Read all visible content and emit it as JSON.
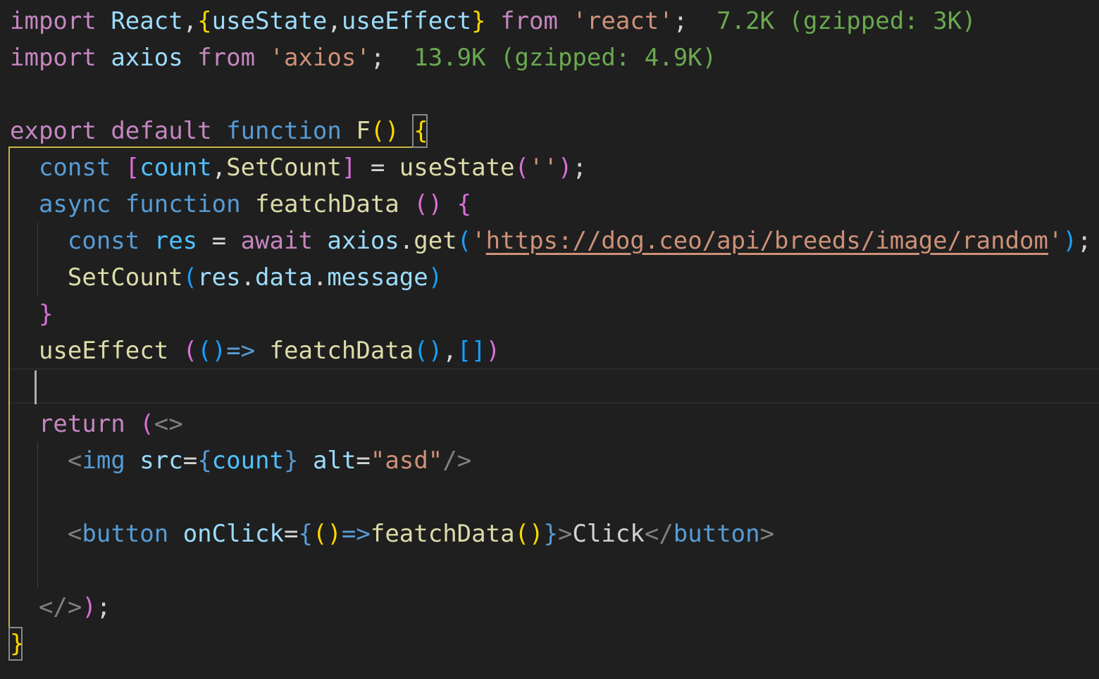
{
  "editor": {
    "colors": {
      "background": "#1f1f1f",
      "keyword_purple": "#c586c0",
      "keyword_blue": "#569cd6",
      "variable": "#9cdcfe",
      "function": "#dcdcaa",
      "string": "#ce9178",
      "plain": "#d4d4d4",
      "bracket_gold": "#ffd700",
      "bracket_pink": "#da70d6",
      "bracket_blue": "#179fff",
      "tag_punct": "#808080",
      "import_cost": "#6aa94f",
      "scope_highlight": "#c8b445"
    },
    "lines": [
      {
        "tokens": [
          {
            "text": "import",
            "color": "#c586c0"
          },
          {
            "text": " ",
            "color": "#d4d4d4"
          },
          {
            "text": "React",
            "color": "#9cdcfe"
          },
          {
            "text": ",",
            "color": "#d4d4d4"
          },
          {
            "text": "{",
            "color": "#ffd700"
          },
          {
            "text": "useState",
            "color": "#9cdcfe"
          },
          {
            "text": ",",
            "color": "#d4d4d4"
          },
          {
            "text": "useEffect",
            "color": "#9cdcfe"
          },
          {
            "text": "}",
            "color": "#ffd700"
          },
          {
            "text": " ",
            "color": "#d4d4d4"
          },
          {
            "text": "from",
            "color": "#c586c0"
          },
          {
            "text": " ",
            "color": "#d4d4d4"
          },
          {
            "text": "'react'",
            "color": "#ce9178"
          },
          {
            "text": ";",
            "color": "#d4d4d4"
          },
          {
            "text": "  7.2K (gzipped: 3K)",
            "color": "#6aa94f"
          }
        ]
      },
      {
        "tokens": [
          {
            "text": "import",
            "color": "#c586c0"
          },
          {
            "text": " ",
            "color": "#d4d4d4"
          },
          {
            "text": "axios",
            "color": "#9cdcfe"
          },
          {
            "text": " ",
            "color": "#d4d4d4"
          },
          {
            "text": "from",
            "color": "#c586c0"
          },
          {
            "text": " ",
            "color": "#d4d4d4"
          },
          {
            "text": "'axios'",
            "color": "#ce9178"
          },
          {
            "text": ";",
            "color": "#d4d4d4"
          },
          {
            "text": "  13.9K (gzipped: 4.9K)",
            "color": "#6aa94f"
          }
        ]
      },
      {
        "tokens": []
      },
      {
        "tokens": [
          {
            "text": "export",
            "color": "#c586c0"
          },
          {
            "text": " ",
            "color": "#d4d4d4"
          },
          {
            "text": "default",
            "color": "#c586c0"
          },
          {
            "text": " ",
            "color": "#d4d4d4"
          },
          {
            "text": "function",
            "color": "#569cd6"
          },
          {
            "text": " ",
            "color": "#d4d4d4"
          },
          {
            "text": "F",
            "color": "#dcdcaa"
          },
          {
            "text": "()",
            "color": "#ffd700"
          },
          {
            "text": " ",
            "color": "#d4d4d4"
          },
          {
            "text": "{",
            "color": "#ffd700"
          }
        ]
      },
      {
        "tokens": [
          {
            "text": "  ",
            "color": "#d4d4d4"
          },
          {
            "text": "const",
            "color": "#569cd6"
          },
          {
            "text": " ",
            "color": "#d4d4d4"
          },
          {
            "text": "[",
            "color": "#da70d6"
          },
          {
            "text": "count",
            "color": "#4fc1ff"
          },
          {
            "text": ",",
            "color": "#d4d4d4"
          },
          {
            "text": "SetCount",
            "color": "#dcdcaa"
          },
          {
            "text": "]",
            "color": "#da70d6"
          },
          {
            "text": " = ",
            "color": "#d4d4d4"
          },
          {
            "text": "useState",
            "color": "#dcdcaa"
          },
          {
            "text": "(",
            "color": "#da70d6"
          },
          {
            "text": "''",
            "color": "#ce9178"
          },
          {
            "text": ")",
            "color": "#da70d6"
          },
          {
            "text": ";",
            "color": "#d4d4d4"
          }
        ]
      },
      {
        "tokens": [
          {
            "text": "  ",
            "color": "#d4d4d4"
          },
          {
            "text": "async",
            "color": "#569cd6"
          },
          {
            "text": " ",
            "color": "#d4d4d4"
          },
          {
            "text": "function",
            "color": "#569cd6"
          },
          {
            "text": " ",
            "color": "#d4d4d4"
          },
          {
            "text": "featchData",
            "color": "#dcdcaa"
          },
          {
            "text": " ",
            "color": "#d4d4d4"
          },
          {
            "text": "()",
            "color": "#da70d6"
          },
          {
            "text": " ",
            "color": "#d4d4d4"
          },
          {
            "text": "{",
            "color": "#da70d6"
          }
        ]
      },
      {
        "tokens": [
          {
            "text": "    ",
            "color": "#d4d4d4"
          },
          {
            "text": "const",
            "color": "#569cd6"
          },
          {
            "text": " ",
            "color": "#d4d4d4"
          },
          {
            "text": "res",
            "color": "#4fc1ff"
          },
          {
            "text": " = ",
            "color": "#d4d4d4"
          },
          {
            "text": "await",
            "color": "#c586c0"
          },
          {
            "text": " ",
            "color": "#d4d4d4"
          },
          {
            "text": "axios",
            "color": "#9cdcfe"
          },
          {
            "text": ".",
            "color": "#d4d4d4"
          },
          {
            "text": "get",
            "color": "#dcdcaa"
          },
          {
            "text": "(",
            "color": "#179fff"
          },
          {
            "text": "'",
            "color": "#ce9178"
          },
          {
            "text": "https://dog.ceo/api/breeds/image/random",
            "color": "#ce9178",
            "url": true
          },
          {
            "text": "'",
            "color": "#ce9178"
          },
          {
            "text": ")",
            "color": "#179fff"
          },
          {
            "text": ";",
            "color": "#d4d4d4"
          }
        ]
      },
      {
        "tokens": [
          {
            "text": "    ",
            "color": "#d4d4d4"
          },
          {
            "text": "SetCount",
            "color": "#dcdcaa"
          },
          {
            "text": "(",
            "color": "#179fff"
          },
          {
            "text": "res",
            "color": "#9cdcfe"
          },
          {
            "text": ".",
            "color": "#d4d4d4"
          },
          {
            "text": "data",
            "color": "#9cdcfe"
          },
          {
            "text": ".",
            "color": "#d4d4d4"
          },
          {
            "text": "message",
            "color": "#9cdcfe"
          },
          {
            "text": ")",
            "color": "#179fff"
          }
        ]
      },
      {
        "tokens": [
          {
            "text": "  ",
            "color": "#d4d4d4"
          },
          {
            "text": "}",
            "color": "#da70d6"
          }
        ]
      },
      {
        "tokens": [
          {
            "text": "  ",
            "color": "#d4d4d4"
          },
          {
            "text": "useEffect",
            "color": "#dcdcaa"
          },
          {
            "text": " ",
            "color": "#d4d4d4"
          },
          {
            "text": "(",
            "color": "#da70d6"
          },
          {
            "text": "()",
            "color": "#179fff"
          },
          {
            "text": "=>",
            "color": "#569cd6"
          },
          {
            "text": " ",
            "color": "#d4d4d4"
          },
          {
            "text": "featchData",
            "color": "#dcdcaa"
          },
          {
            "text": "()",
            "color": "#179fff"
          },
          {
            "text": ",",
            "color": "#d4d4d4"
          },
          {
            "text": "[]",
            "color": "#179fff"
          },
          {
            "text": ")",
            "color": "#da70d6"
          }
        ]
      },
      {
        "tokens": []
      },
      {
        "tokens": [
          {
            "text": "  ",
            "color": "#d4d4d4"
          },
          {
            "text": "return",
            "color": "#c586c0"
          },
          {
            "text": " ",
            "color": "#d4d4d4"
          },
          {
            "text": "(",
            "color": "#da70d6"
          },
          {
            "text": "<>",
            "color": "#808080"
          }
        ]
      },
      {
        "tokens": [
          {
            "text": "    ",
            "color": "#d4d4d4"
          },
          {
            "text": "<",
            "color": "#808080"
          },
          {
            "text": "img",
            "color": "#569cd6"
          },
          {
            "text": " ",
            "color": "#d4d4d4"
          },
          {
            "text": "src",
            "color": "#9cdcfe"
          },
          {
            "text": "=",
            "color": "#d4d4d4"
          },
          {
            "text": "{",
            "color": "#569cd6"
          },
          {
            "text": "count",
            "color": "#4fc1ff"
          },
          {
            "text": "}",
            "color": "#569cd6"
          },
          {
            "text": " ",
            "color": "#d4d4d4"
          },
          {
            "text": "alt",
            "color": "#9cdcfe"
          },
          {
            "text": "=",
            "color": "#d4d4d4"
          },
          {
            "text": "\"asd\"",
            "color": "#ce9178"
          },
          {
            "text": "/>",
            "color": "#808080"
          }
        ]
      },
      {
        "tokens": []
      },
      {
        "tokens": [
          {
            "text": "    ",
            "color": "#d4d4d4"
          },
          {
            "text": "<",
            "color": "#808080"
          },
          {
            "text": "button",
            "color": "#569cd6"
          },
          {
            "text": " ",
            "color": "#d4d4d4"
          },
          {
            "text": "onClick",
            "color": "#9cdcfe"
          },
          {
            "text": "=",
            "color": "#d4d4d4"
          },
          {
            "text": "{",
            "color": "#569cd6"
          },
          {
            "text": "()",
            "color": "#ffd700"
          },
          {
            "text": "=>",
            "color": "#569cd6"
          },
          {
            "text": "featchData",
            "color": "#dcdcaa"
          },
          {
            "text": "()",
            "color": "#ffd700"
          },
          {
            "text": "}",
            "color": "#569cd6"
          },
          {
            "text": ">",
            "color": "#808080"
          },
          {
            "text": "Click",
            "color": "#d4d4d4"
          },
          {
            "text": "</",
            "color": "#808080"
          },
          {
            "text": "button",
            "color": "#569cd6"
          },
          {
            "text": ">",
            "color": "#808080"
          }
        ]
      },
      {
        "tokens": []
      },
      {
        "tokens": [
          {
            "text": "  ",
            "color": "#d4d4d4"
          },
          {
            "text": "</>",
            "color": "#808080"
          },
          {
            "text": ")",
            "color": "#da70d6"
          },
          {
            "text": ";",
            "color": "#d4d4d4"
          }
        ]
      },
      {
        "tokens": [
          {
            "text": "}",
            "color": "#ffd700"
          }
        ]
      }
    ]
  }
}
